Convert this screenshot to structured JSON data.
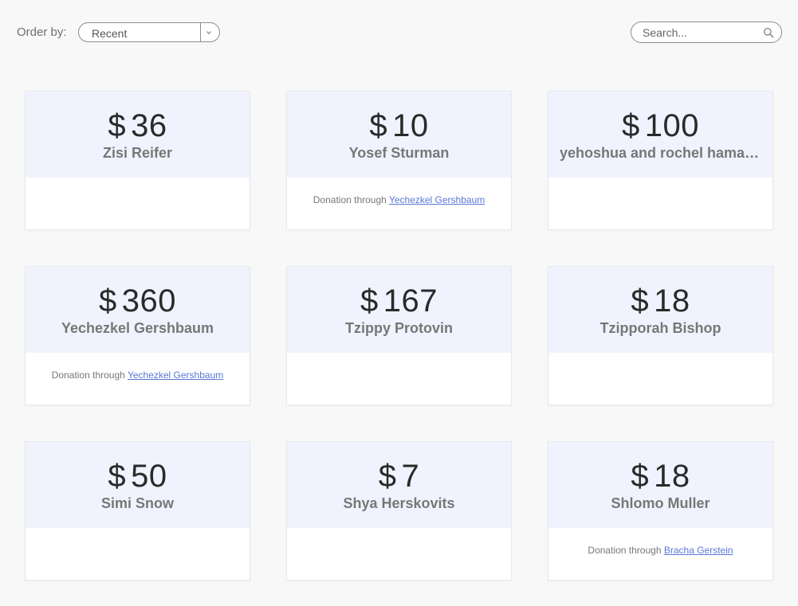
{
  "toolbar": {
    "order_label": "Order by:",
    "order_value": "Recent",
    "search_placeholder": "Search..."
  },
  "currency_symbol": "$",
  "donation_through_label": "Donation through",
  "donations": [
    {
      "amount": "36",
      "donor": "Zisi Reifer",
      "via": ""
    },
    {
      "amount": "10",
      "donor": "Yosef Sturman",
      "via": "Yechezkel Gershbaum"
    },
    {
      "amount": "100",
      "donor": "yehoshua and rochel hamaoui",
      "via": ""
    },
    {
      "amount": "360",
      "donor": "Yechezkel Gershbaum",
      "via": "Yechezkel Gershbaum"
    },
    {
      "amount": "167",
      "donor": "Tzippy Protovin",
      "via": ""
    },
    {
      "amount": "18",
      "donor": "Tzipporah Bishop",
      "via": ""
    },
    {
      "amount": "50",
      "donor": "Simi Snow",
      "via": ""
    },
    {
      "amount": "7",
      "donor": "Shya Herskovits",
      "via": ""
    },
    {
      "amount": "18",
      "donor": "Shlomo Muller",
      "via": "Bracha Gerstein"
    }
  ],
  "colors": {
    "card_header": "#f0f3fd",
    "link": "#5b78d6",
    "page_bg": "#f8f8f9"
  },
  "icons": {
    "dropdown": "chevron-down-icon",
    "search": "search-icon"
  }
}
